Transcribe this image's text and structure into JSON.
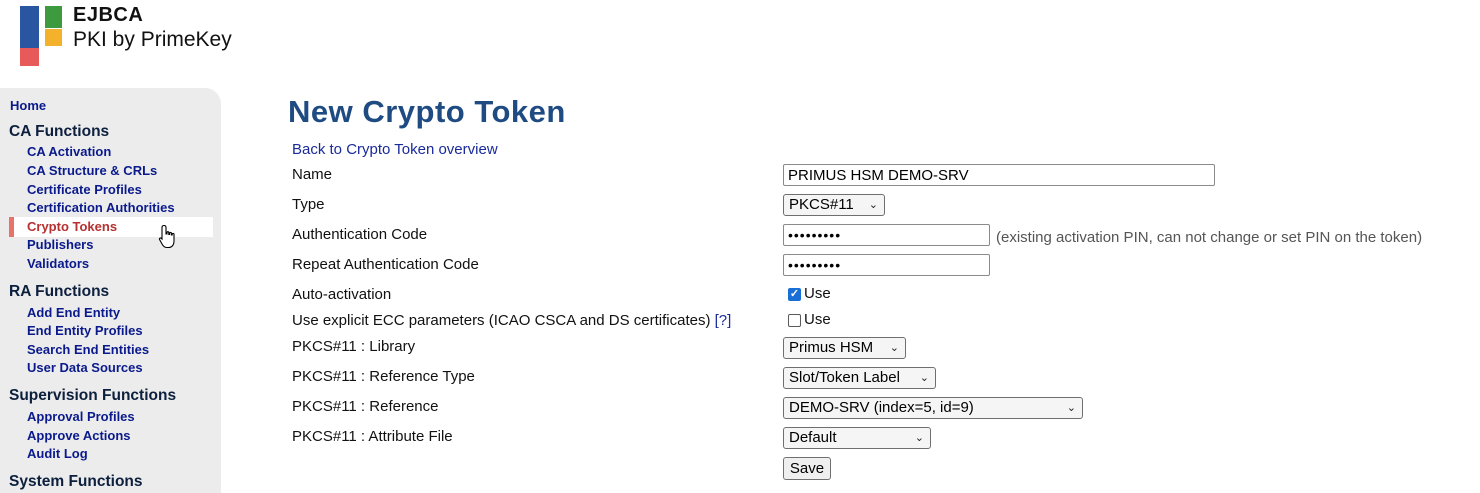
{
  "brand": {
    "name": "EJBCA",
    "tagline": "PKI by PrimeKey"
  },
  "sidebar": {
    "home": "Home",
    "sections": [
      {
        "title": "CA Functions",
        "items": [
          "CA Activation",
          "CA Structure & CRLs",
          "Certificate Profiles",
          "Certification Authorities",
          "Crypto Tokens",
          "Publishers",
          "Validators"
        ]
      },
      {
        "title": "RA Functions",
        "items": [
          "Add End Entity",
          "End Entity Profiles",
          "Search End Entities",
          "User Data Sources"
        ]
      },
      {
        "title": "Supervision Functions",
        "items": [
          "Approval Profiles",
          "Approve Actions",
          "Audit Log"
        ]
      },
      {
        "title": "System Functions",
        "items": []
      }
    ],
    "active_item": "Crypto Tokens"
  },
  "main": {
    "title": "New Crypto Token",
    "back_link": "Back to Crypto Token overview",
    "form": {
      "name": {
        "label": "Name",
        "value": "PRIMUS HSM DEMO-SRV"
      },
      "type": {
        "label": "Type",
        "value": "PKCS#11"
      },
      "auth_code": {
        "label": "Authentication Code",
        "value": "•••••••••",
        "hint": "(existing activation PIN, can not change or set PIN on the token)"
      },
      "repeat_auth_code": {
        "label": "Repeat Authentication Code",
        "value": "•••••••••"
      },
      "auto_activation": {
        "label": "Auto-activation",
        "checked": true,
        "check_label": "Use"
      },
      "explicit_ecc": {
        "label": "Use explicit ECC parameters (ICAO CSCA and DS certificates)",
        "help": "[?]",
        "checked": false,
        "check_label": "Use"
      },
      "library": {
        "label": "PKCS#11 : Library",
        "value": "Primus HSM"
      },
      "reference_type": {
        "label": "PKCS#11 : Reference Type",
        "value": "Slot/Token Label"
      },
      "reference": {
        "label": "PKCS#11 : Reference",
        "value": "DEMO-SRV (index=5, id=9)"
      },
      "attribute_file": {
        "label": "PKCS#11 : Attribute File",
        "value": "Default"
      },
      "save_label": "Save"
    }
  },
  "colors": {
    "title": "#1f4b83",
    "nav_link": "#0a1a8c",
    "active": "#b53131",
    "accent_bar": "#e8736a"
  }
}
